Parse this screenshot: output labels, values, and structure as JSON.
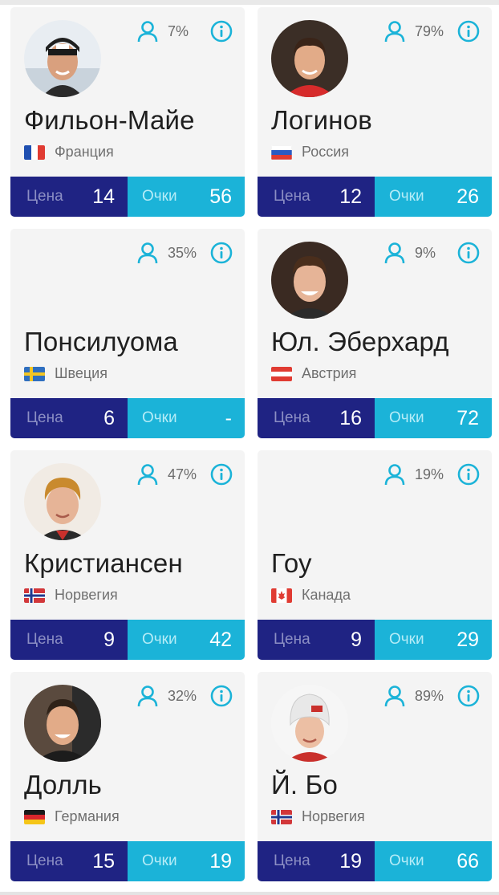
{
  "labels": {
    "price": "Цена",
    "points": "Очки"
  },
  "colors": {
    "price_bg": "#1f2383",
    "points_bg": "#1bb3d8",
    "icon_accent": "#1bb3d8"
  },
  "players": [
    {
      "name": "Фильон-Майе",
      "country": "Франция",
      "flag": "france",
      "ownership": "7%",
      "price": "14",
      "points": "56",
      "has_photo": true
    },
    {
      "name": "Логинов",
      "country": "Россия",
      "flag": "russia",
      "ownership": "79%",
      "price": "12",
      "points": "26",
      "has_photo": true
    },
    {
      "name": "Понсилуома",
      "country": "Швеция",
      "flag": "sweden",
      "ownership": "35%",
      "price": "6",
      "points": "-",
      "has_photo": false
    },
    {
      "name": "Юл. Эберхард",
      "country": "Австрия",
      "flag": "austria",
      "ownership": "9%",
      "price": "16",
      "points": "72",
      "has_photo": true
    },
    {
      "name": "Кристиансен",
      "country": "Норвегия",
      "flag": "norway",
      "ownership": "47%",
      "price": "9",
      "points": "42",
      "has_photo": true
    },
    {
      "name": "Гоу",
      "country": "Канада",
      "flag": "canada",
      "ownership": "19%",
      "price": "9",
      "points": "29",
      "has_photo": false
    },
    {
      "name": "Долль",
      "country": "Германия",
      "flag": "germany",
      "ownership": "32%",
      "price": "15",
      "points": "19",
      "has_photo": true
    },
    {
      "name": "Й. Бо",
      "country": "Норвегия",
      "flag": "norway",
      "ownership": "89%",
      "price": "19",
      "points": "66",
      "has_photo": true
    }
  ]
}
